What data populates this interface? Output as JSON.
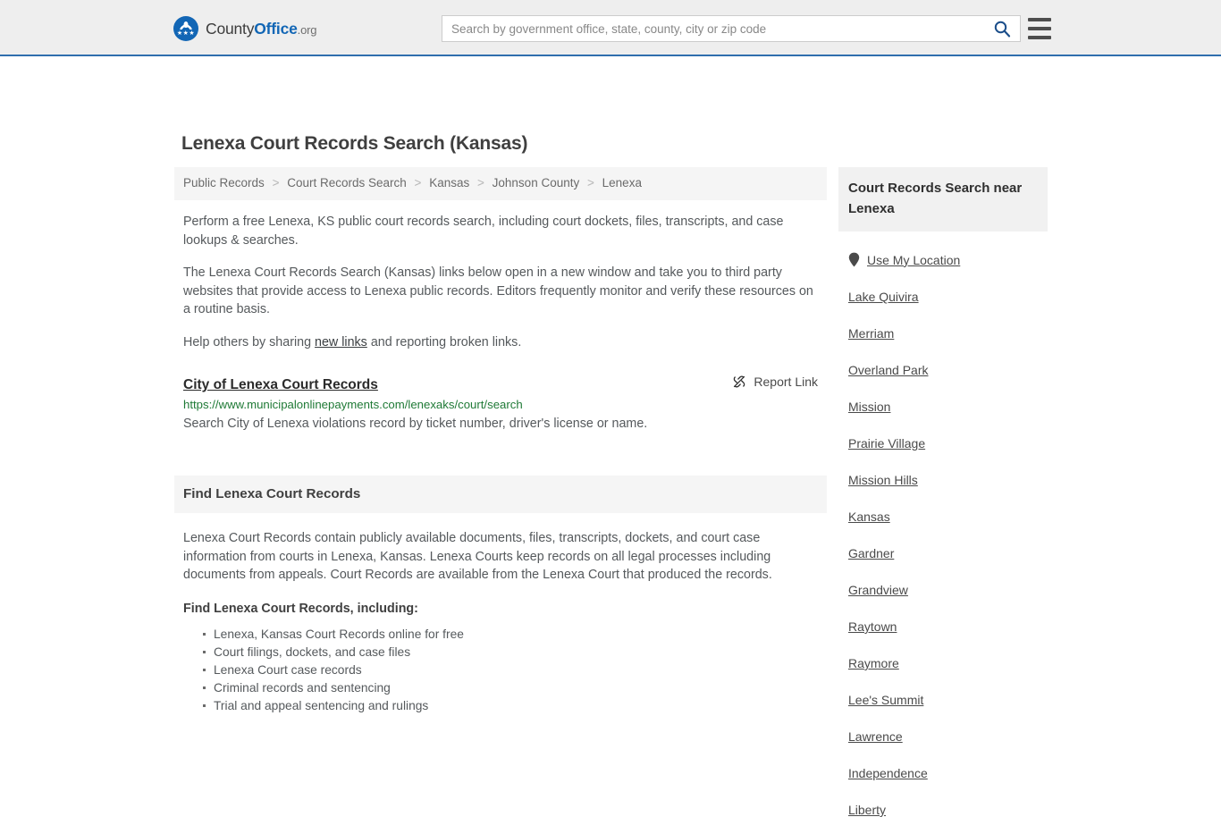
{
  "header": {
    "brand": {
      "part1": "County",
      "part2": "Office",
      "part3": ".org",
      "logo_icon": "eagle-shield-logo"
    },
    "search": {
      "placeholder": "Search by government office, state, county, city or zip code",
      "value": "",
      "search_icon": "search-icon"
    },
    "menu_icon": "hamburger-menu-icon",
    "accent_color": "#1266b5",
    "border_color": "#2f6ead"
  },
  "page": {
    "title": "Lenexa Court Records Search (Kansas)"
  },
  "breadcrumb": {
    "items": [
      {
        "label": "Public Records"
      },
      {
        "label": "Court Records Search"
      },
      {
        "label": "Kansas"
      },
      {
        "label": "Johnson County"
      },
      {
        "label": "Lenexa"
      }
    ],
    "separator": ">"
  },
  "intro": {
    "p1": "Perform a free Lenexa, KS public court records search, including court dockets, files, transcripts, and case lookups & searches.",
    "p2": "The Lenexa Court Records Search (Kansas) links below open in a new window and take you to third party websites that provide access to Lenexa public records. Editors frequently monitor and verify these resources on a routine basis.",
    "p3_before": "Help others by sharing ",
    "p3_link": "new links",
    "p3_after": " and reporting broken links."
  },
  "result": {
    "title": "City of Lenexa Court Records",
    "url": "https://www.municipalonlinepayments.com/lenexaks/court/search",
    "description": "Search City of Lenexa violations record by ticket number, driver's license or name.",
    "report_label": "Report Link",
    "report_icon": "broken-link-icon",
    "url_color": "#1f7a36"
  },
  "section": {
    "heading": "Find Lenexa Court Records",
    "body": "Lenexa Court Records contain publicly available documents, files, transcripts, dockets, and court case information from courts in Lenexa, Kansas. Lenexa Courts keep records on all legal processes including documents from appeals. Court Records are available from the Lenexa Court that produced the records.",
    "subheading": "Find Lenexa Court Records, including:",
    "bullets": [
      "Lenexa, Kansas Court Records online for free",
      "Court filings, dockets, and case files",
      "Lenexa Court case records",
      "Criminal records and sentencing",
      "Trial and appeal sentencing and rulings"
    ]
  },
  "sidebar": {
    "heading": "Court Records Search near Lenexa",
    "use_location": {
      "label": "Use My Location",
      "icon": "map-pin-icon"
    },
    "links": [
      {
        "label": "Lake Quivira"
      },
      {
        "label": "Merriam"
      },
      {
        "label": "Overland Park"
      },
      {
        "label": "Mission"
      },
      {
        "label": "Prairie Village"
      },
      {
        "label": "Mission Hills"
      },
      {
        "label": "Kansas"
      },
      {
        "label": "Gardner"
      },
      {
        "label": "Grandview"
      },
      {
        "label": "Raytown"
      },
      {
        "label": "Raymore"
      },
      {
        "label": "Lee's Summit"
      },
      {
        "label": "Lawrence"
      },
      {
        "label": "Independence"
      },
      {
        "label": "Liberty"
      }
    ]
  }
}
